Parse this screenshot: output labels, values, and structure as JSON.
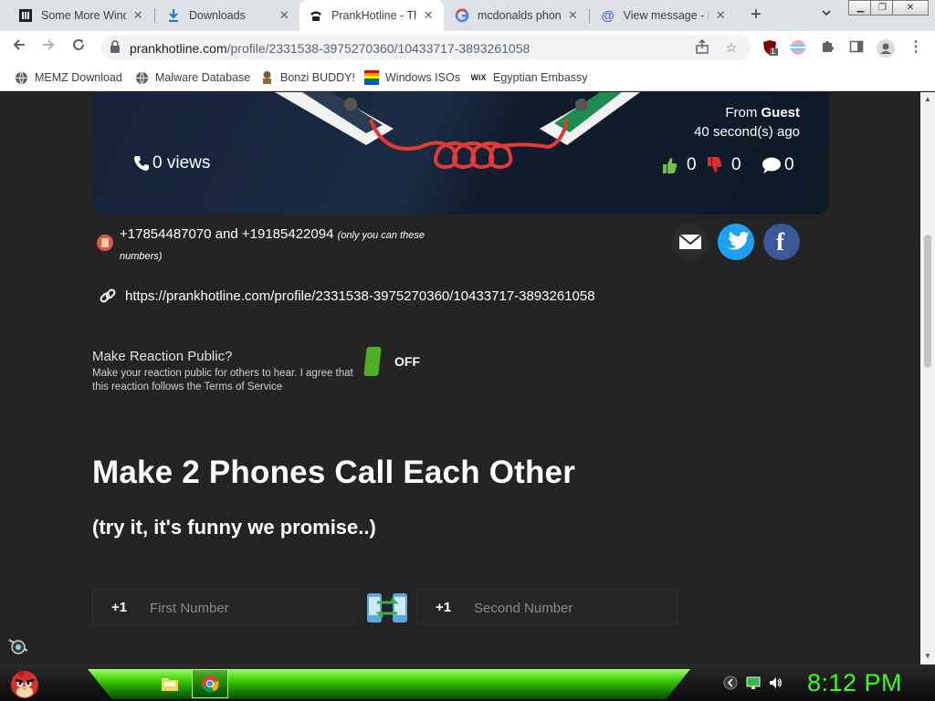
{
  "browser": {
    "tabs": [
      {
        "title": "Some More Wind",
        "favicon": "museum-icon"
      },
      {
        "title": "Downloads",
        "favicon": "download-icon"
      },
      {
        "title": "PrankHotline - Th",
        "favicon": "phone-icon",
        "active": true
      },
      {
        "title": "mcdonalds phone",
        "favicon": "google-icon"
      },
      {
        "title": "View message - M",
        "favicon": "at-icon"
      }
    ],
    "url_host": "prankhotline.com",
    "url_path": "/profile/2331538-3975270360/10433717-3893261058",
    "extension_badge": "1",
    "bookmarks": [
      {
        "label": "MEMZ Download",
        "icon": "globe-icon"
      },
      {
        "label": "Malware Database",
        "icon": "globe-icon"
      },
      {
        "label": "Bonzi BUDDY!",
        "icon": "bonzi-icon"
      },
      {
        "label": "Windows ISOs",
        "icon": "windows-icon"
      },
      {
        "label": "Egyptian Embassy",
        "icon": "wix-icon"
      }
    ]
  },
  "page": {
    "views_count": "0 views",
    "from_prefix": "From ",
    "from_name": "Guest",
    "time_ago": "40 second(s) ago",
    "likes": "0",
    "dislikes": "0",
    "comments": "0",
    "numbers_text": "+17854487070 and +19185422094",
    "numbers_note": "(only you can these numbers)",
    "share_link": "https://prankhotline.com/profile/2331538-3975270360/10433717-3893261058",
    "reaction_title": "Make Reaction Public?",
    "reaction_desc": "Make your reaction public for others to hear. I agree that this reaction follows the Terms of Service",
    "toggle_state": "OFF",
    "headline": "Make 2 Phones Call Each Other",
    "subline": "(try it, it's funny we promise..)",
    "first_cc": "+1",
    "first_placeholder": "First Number",
    "second_cc": "+1",
    "second_placeholder": "Second Number"
  },
  "taskbar": {
    "clock": "8:12 PM"
  },
  "colors": {
    "accent_green": "#4caf24",
    "clock_green": "#39ff14",
    "twitter_blue": "#1da1f2",
    "facebook_blue": "#3b5998",
    "thumb_up": "#6cc644",
    "thumb_down": "#d9302c"
  }
}
